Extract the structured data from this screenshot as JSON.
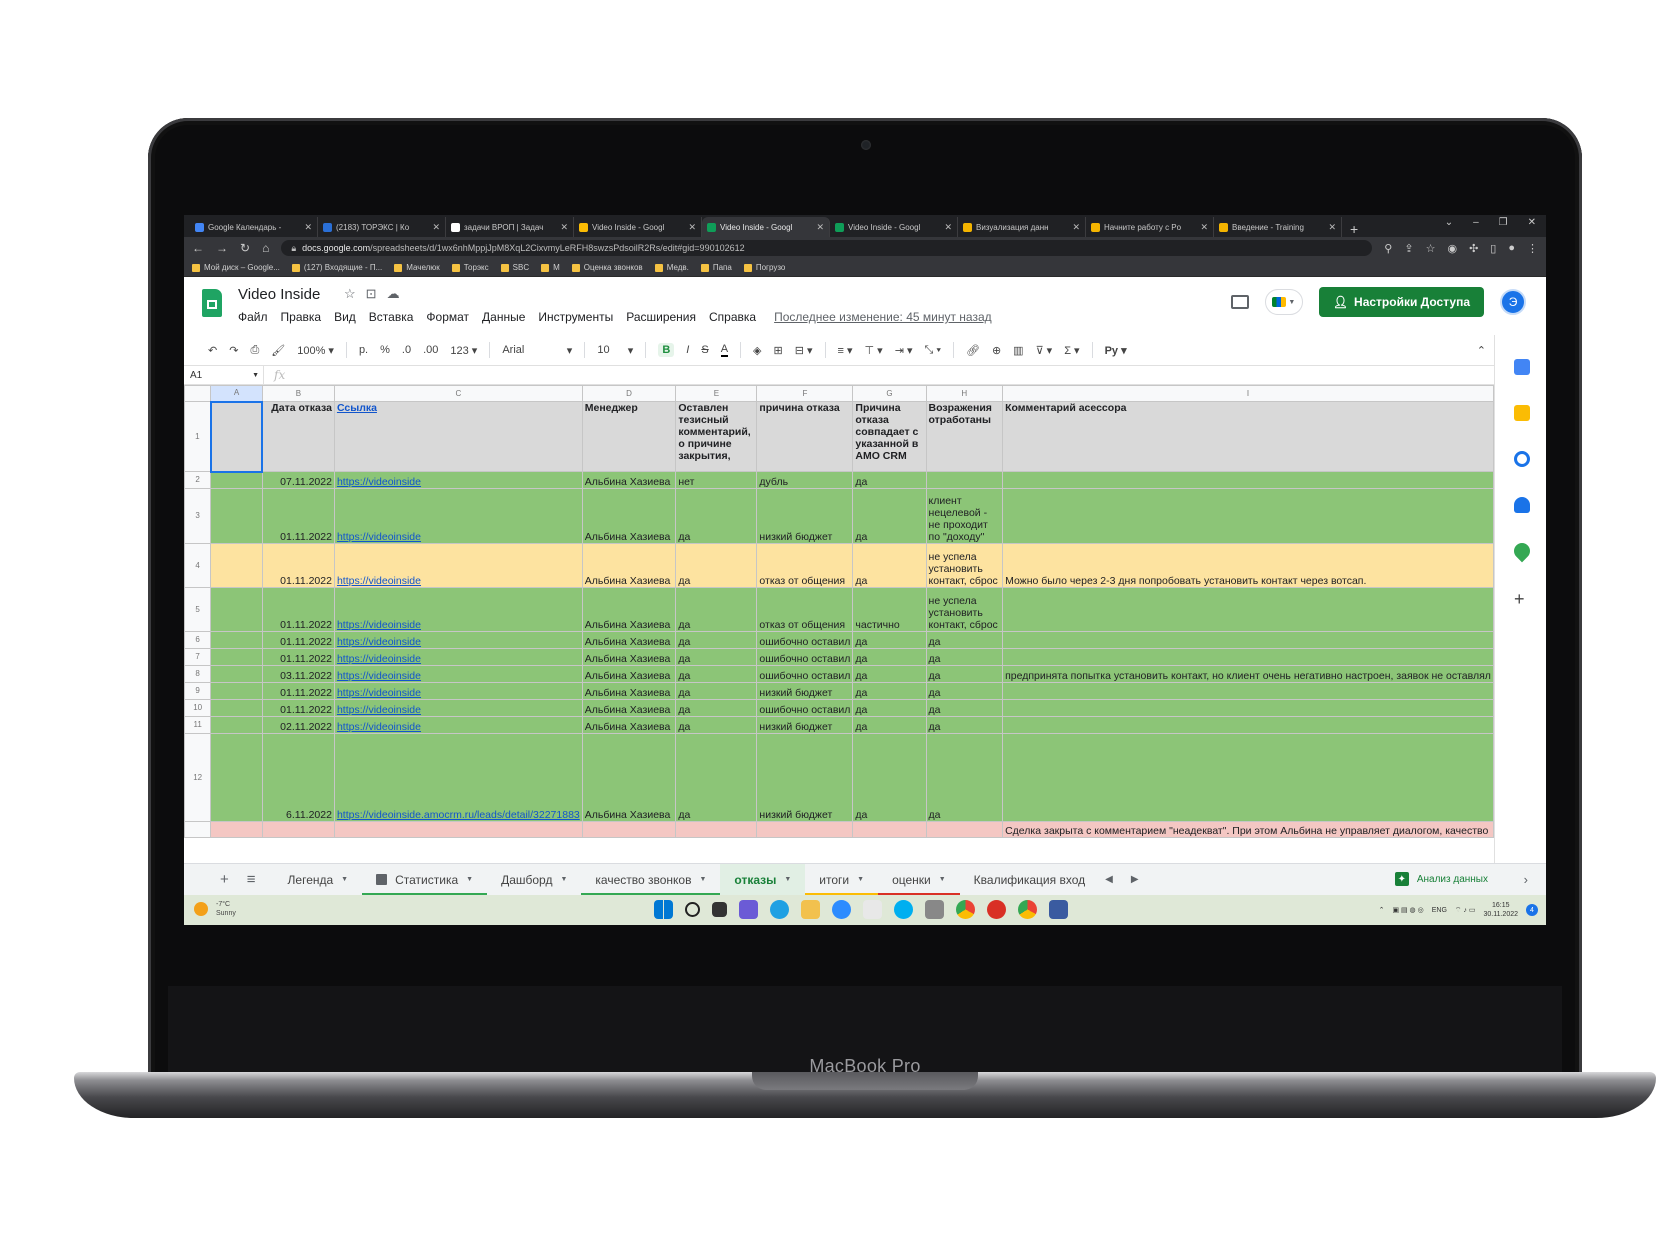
{
  "laptop": {
    "brand": "MacBook Pro"
  },
  "browser": {
    "tabs": [
      {
        "title": "Google Календарь - ",
        "color": "#4285f4",
        "active": false
      },
      {
        "title": "(2183) ТОРЭКС | Ко",
        "color": "#2a6fd6",
        "active": false
      },
      {
        "title": "задачи ВРОП | Задач",
        "color": "#ffffff",
        "active": false
      },
      {
        "title": "Video Inside - Googl",
        "color": "#fbbc04",
        "active": false
      },
      {
        "title": "Video Inside - Googl",
        "color": "#0f9d58",
        "active": true
      },
      {
        "title": "Video Inside - Googl",
        "color": "#0f9d58",
        "active": false
      },
      {
        "title": "Визуализация данн",
        "color": "#f4b400",
        "active": false
      },
      {
        "title": "Начните работу с Po",
        "color": "#f4b400",
        "active": false
      },
      {
        "title": "Введение - Training",
        "color": "#f4b400",
        "active": false
      }
    ],
    "new_tab": "+",
    "url_domain": "docs.google.com",
    "url_path": "/spreadsheets/d/1wx6nhMppjJpM8XqL2CixvmyLeRFH8swzsPdsoilR2Rs/edit#gid=990102612",
    "bookmarks": [
      "Мой диск – Google...",
      "(127) Входящие - П...",
      "Мачелюк",
      "Торэкс",
      "SBC",
      "M",
      "Оценка звонков",
      "Медв.",
      "Папа",
      "Погрузо"
    ]
  },
  "sheets": {
    "doc_title": "Video Inside",
    "menu": [
      "Файл",
      "Правка",
      "Вид",
      "Вставка",
      "Формат",
      "Данные",
      "Инструменты",
      "Расширения",
      "Справка"
    ],
    "last_edit": "Последнее изменение: 45 минут назад",
    "share_button": "Настройки Доступа",
    "avatar_letter": "Э",
    "toolbar": {
      "zoom": "100%",
      "currency": "р.",
      "percent": "%",
      "dec_less": ".0",
      "dec_more": ".00",
      "format_123": "123",
      "font": "Arial",
      "font_size": "10",
      "bold": "B",
      "italic": "I",
      "strike": "S",
      "text_color": "A",
      "input_tools": "Рy"
    },
    "name_box": "A1",
    "fx": "fx",
    "columns": [
      "A",
      "B",
      "C",
      "D",
      "E",
      "F",
      "G",
      "H",
      "I"
    ],
    "header_row": {
      "num": "1",
      "cells": [
        "",
        "Дата отказа",
        "Ссылка",
        "Менеджер",
        "Оставлен тезисный комментарий, о причине закрытия,",
        "причина отказа",
        "Причина отказа совпадает с указанной в AMO CRM",
        "Возражения отработаны",
        "Комментарий асессора"
      ]
    },
    "rows": [
      {
        "num": "2",
        "color": "green",
        "cells": [
          "",
          "07.11.2022",
          "https://videoinside",
          "Альбина Хазиева",
          "нет",
          "дубль",
          "да",
          "",
          ""
        ]
      },
      {
        "num": "3",
        "color": "green",
        "cells": [
          "",
          "01.11.2022",
          "https://videoinside",
          "Альбина Хазиева",
          "да",
          "низкий бюджет",
          "да",
          "клиент нецелевой - не проходит по \"доходу\"",
          ""
        ]
      },
      {
        "num": "4",
        "color": "yellow",
        "cells": [
          "",
          "01.11.2022",
          "https://videoinside",
          "Альбина Хазиева",
          "да",
          "отказ от общения",
          "да",
          "не успела установить контакт, сброс",
          "Можно было через 2-3 дня попробовать установить контакт через вотсап."
        ]
      },
      {
        "num": "5",
        "color": "green",
        "cells": [
          "",
          "01.11.2022",
          "https://videoinside",
          "Альбина Хазиева",
          "да",
          "отказ от общения",
          "частично",
          "не успела установить контакт, сброс",
          ""
        ]
      },
      {
        "num": "6",
        "color": "green",
        "cells": [
          "",
          "01.11.2022",
          "https://videoinside",
          "Альбина Хазиева",
          "да",
          "ошибочно оставил",
          "да",
          "да",
          ""
        ]
      },
      {
        "num": "7",
        "color": "green",
        "cells": [
          "",
          "01.11.2022",
          "https://videoinside",
          "Альбина Хазиева",
          "да",
          "ошибочно оставил",
          "да",
          "да",
          ""
        ]
      },
      {
        "num": "8",
        "color": "green",
        "cells": [
          "",
          "03.11.2022",
          "https://videoinside",
          "Альбина Хазиева",
          "да",
          "ошибочно оставил",
          "да",
          "да",
          "предпринята попытка установить контакт, но клиент очень негативно настроен, заявок не оставлял"
        ]
      },
      {
        "num": "9",
        "color": "green",
        "cells": [
          "",
          "01.11.2022",
          "https://videoinside",
          "Альбина Хазиева",
          "да",
          "низкий бюджет",
          "да",
          "да",
          ""
        ]
      },
      {
        "num": "10",
        "color": "green",
        "cells": [
          "",
          "01.11.2022",
          "https://videoinside",
          "Альбина Хазиева",
          "да",
          "ошибочно оставил",
          "да",
          "да",
          ""
        ]
      },
      {
        "num": "11",
        "color": "green",
        "cells": [
          "",
          "02.11.2022",
          "https://videoinside",
          "Альбина Хазиева",
          "да",
          "низкий бюджет",
          "да",
          "да",
          ""
        ]
      },
      {
        "num": "12",
        "color": "green",
        "cells": [
          "",
          "6.11.2022",
          "https://videoinside.amocrm.ru/leads/detail/32271883",
          "Альбина Хазиева",
          "да",
          "низкий бюджет",
          "да",
          "да",
          ""
        ]
      },
      {
        "num": "",
        "color": "pink",
        "cells": [
          "",
          "",
          "",
          "",
          "",
          "",
          "",
          "",
          "Сделка закрыта с комментарием \"неадекват\". При этом Альбина не управляет диалогом, качество"
        ]
      }
    ],
    "sheet_tabs": [
      {
        "label": "Легенда",
        "bar": "",
        "active": false
      },
      {
        "label": "Статистика",
        "bar": "#34a853",
        "active": false
      },
      {
        "label": "Дашборд",
        "bar": "",
        "active": false
      },
      {
        "label": "качество звонков",
        "bar": "#34a853",
        "active": false
      },
      {
        "label": "отказы",
        "bar": "",
        "active": true
      },
      {
        "label": "итоги",
        "bar": "#fbbc04",
        "active": false
      },
      {
        "label": "оценки",
        "bar": "#d93025",
        "active": false
      },
      {
        "label": "Квалификация вход",
        "bar": "",
        "active": false
      }
    ],
    "explore_label": "Анализ данных"
  },
  "taskbar": {
    "weather_temp": "-7°C",
    "weather_desc": "Sunny",
    "lang": "ENG",
    "time": "16:15",
    "date": "30.11.2022",
    "notification_count": "4"
  }
}
